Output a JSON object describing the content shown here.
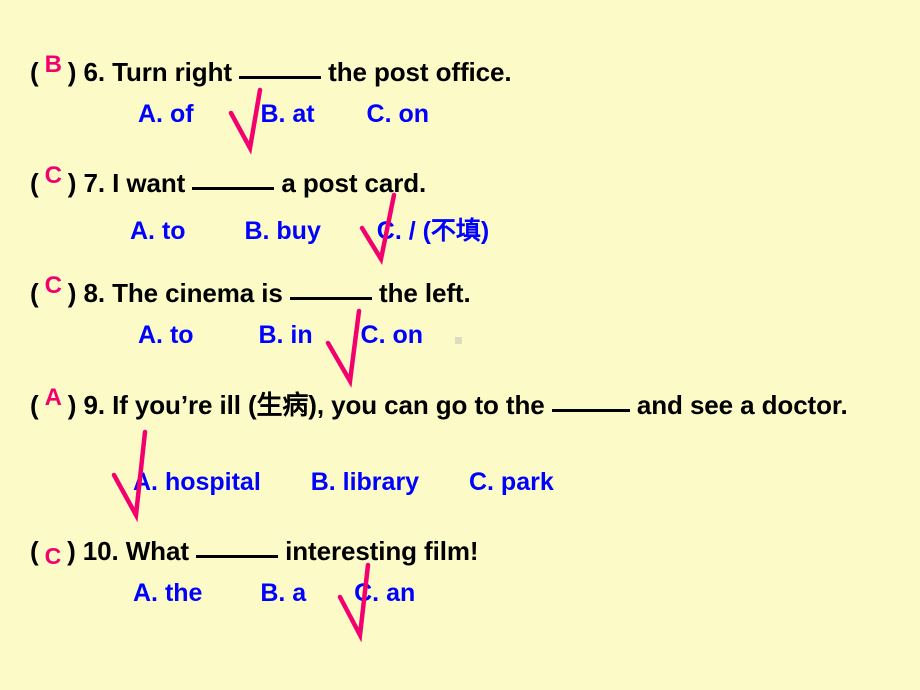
{
  "page": {
    "background_color": "#fcfbc8",
    "stem_color": "#000000",
    "option_color": "#0000ff",
    "answer_color": "#f2006e",
    "tick_color": "#f2006e"
  },
  "questions": [
    {
      "id": "q6",
      "answer": "B",
      "number": "6.",
      "stem_before": "Turn right",
      "stem_after": "the post office.",
      "options": [
        {
          "label": "A. of"
        },
        {
          "label": "B. at"
        },
        {
          "label": "C. on"
        }
      ]
    },
    {
      "id": "q7",
      "answer": "C",
      "number": "7.",
      "stem_before": "I want",
      "stem_after": "a post card.",
      "options": [
        {
          "label": "A. to"
        },
        {
          "label": "B. buy"
        },
        {
          "label": "C. / (不填)"
        }
      ]
    },
    {
      "id": "q8",
      "answer": "C",
      "number": "8.",
      "stem_before": "The cinema is",
      "stem_after": "the left.",
      "options": [
        {
          "label": "A. to"
        },
        {
          "label": "B. in"
        },
        {
          "label": "C. on"
        }
      ]
    },
    {
      "id": "q9",
      "answer": "A",
      "number": "9.",
      "stem_before": "If you’re ill (生病), you can go to the",
      "stem_after": "and see a doctor.",
      "options": [
        {
          "label": "A. hospital"
        },
        {
          "label": "B. library"
        },
        {
          "label": "C. park"
        }
      ]
    },
    {
      "id": "q10",
      "answer": "C",
      "number": "10.",
      "stem_before": "What",
      "stem_after": "interesting film!",
      "options": [
        {
          "label": "A. the"
        },
        {
          "label": "B. a"
        },
        {
          "label": "C. an"
        }
      ]
    }
  ],
  "punctuation": {
    "open_paren": "(",
    "close_paren": ")"
  }
}
